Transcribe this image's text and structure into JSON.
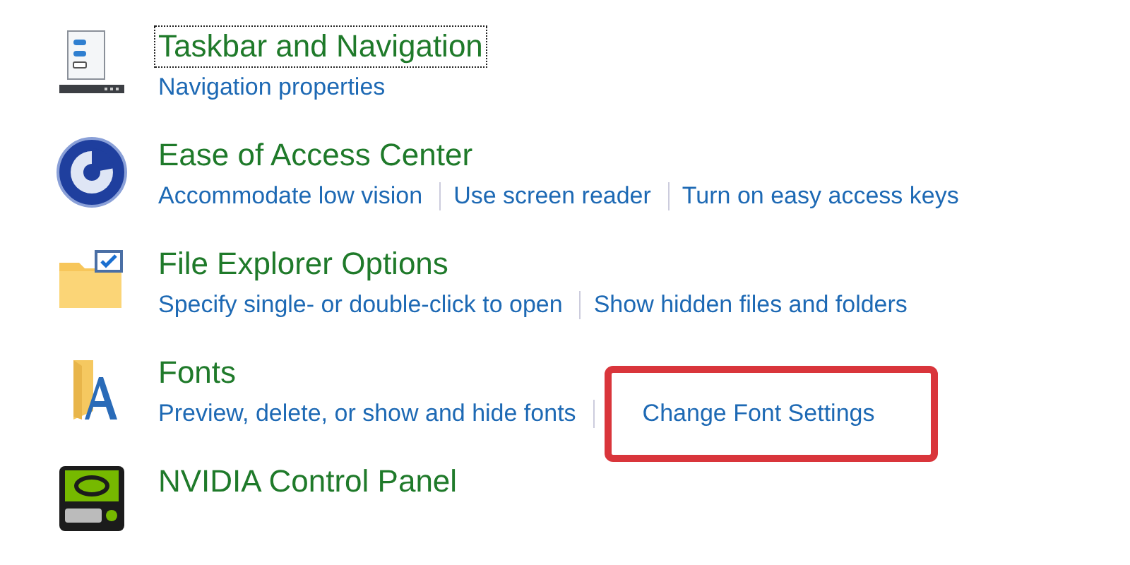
{
  "items": [
    {
      "kind": "taskbar",
      "title": "Taskbar and Navigation",
      "focused": true,
      "links": [
        {
          "label": "Navigation properties",
          "highlighted": false
        }
      ]
    },
    {
      "kind": "access",
      "title": "Ease of Access Center",
      "focused": false,
      "links": [
        {
          "label": "Accommodate low vision",
          "highlighted": false
        },
        {
          "label": "Use screen reader",
          "highlighted": false
        },
        {
          "label": "Turn on easy access keys",
          "highlighted": false
        }
      ]
    },
    {
      "kind": "explorer",
      "title": "File Explorer Options",
      "focused": false,
      "links": [
        {
          "label": "Specify single- or double-click to open",
          "highlighted": false
        },
        {
          "label": "Show hidden files and folders",
          "highlighted": false
        }
      ]
    },
    {
      "kind": "fonts",
      "title": "Fonts",
      "focused": false,
      "links": [
        {
          "label": "Preview, delete, or show and hide fonts",
          "highlighted": false
        },
        {
          "label": "Change Font Settings",
          "highlighted": true
        }
      ]
    },
    {
      "kind": "nvidia",
      "title": "NVIDIA Control Panel",
      "focused": false
    }
  ]
}
